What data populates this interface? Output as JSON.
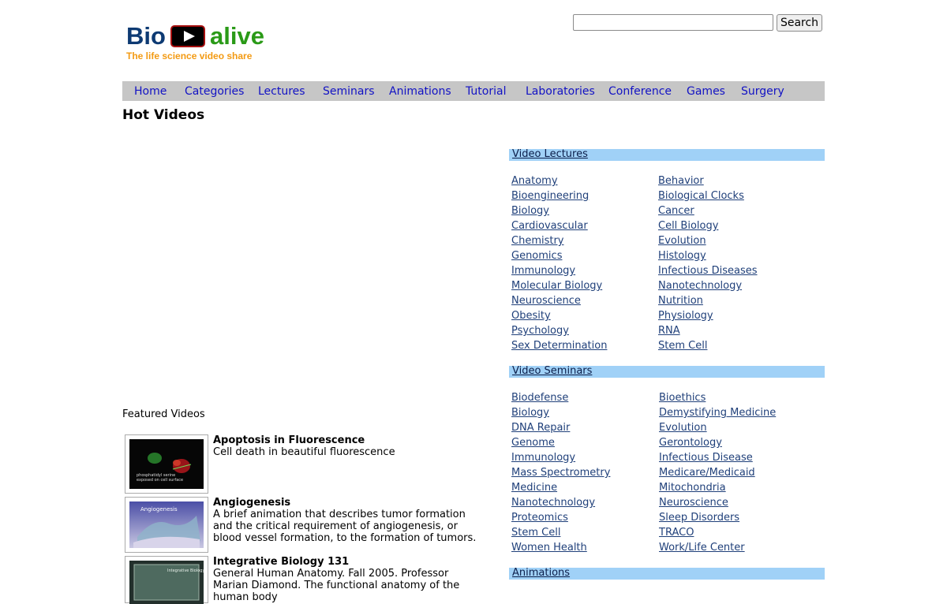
{
  "logo": {
    "bio": "Bio",
    "alive": "alive",
    "tagline": "The life science video share"
  },
  "search": {
    "value": "",
    "placeholder": "",
    "button_label": "Search"
  },
  "nav": [
    "Home",
    "Categories",
    "Lectures",
    "Seminars",
    "Animations",
    "Tutorial",
    "Laboratories",
    "Conference",
    "Games",
    "Surgery"
  ],
  "hot_videos_title": "Hot Videos",
  "featured": {
    "title": "Featured Videos",
    "items": [
      {
        "title": "Apoptosis in Fluorescence",
        "desc": "Cell death in beautiful fluorescence",
        "thumb_caption": "phosphatidyl serine exposed on cell surface"
      },
      {
        "title": "Angiogenesis",
        "desc": "A brief animation that describes tumor formation and the critical requirement of angiogenesis, or blood vessel formation, to the formation of tumors.",
        "thumb_caption": "Angiogenesis"
      },
      {
        "title": "Integrative Biology 131",
        "desc": "General Human Anatomy. Fall 2005. Professor Marian Diamond. The functional anatomy of the human body",
        "thumb_caption": "Integrative Biology"
      }
    ]
  },
  "video_lectures": {
    "heading": "Video Lectures",
    "left": [
      "Anatomy",
      "Bioengineering",
      "Biology",
      "Cardiovascular",
      "Chemistry",
      "Genomics",
      "Immunology",
      "Molecular Biology",
      "Neuroscience",
      "Obesity",
      "Psychology",
      "Sex Determination"
    ],
    "right": [
      "Behavior",
      "Biological Clocks",
      "Cancer",
      "Cell Biology",
      "Evolution",
      "Histology",
      "Infectious Diseases",
      "Nanotechnology",
      "Nutrition",
      "Physiology",
      "RNA",
      "Stem Cell"
    ]
  },
  "video_seminars": {
    "heading": "Video Seminars",
    "left": [
      "Biodefense",
      "Biology",
      "DNA Repair",
      "Genome",
      "Immunology",
      "Mass Spectrometry",
      "Medicine",
      "Nanotechnology",
      "Proteomics",
      "Stem Cell",
      "Women Health"
    ],
    "right": [
      "Bioethics",
      "Demystifying Medicine",
      "Evolution",
      "Gerontology",
      "Infectious Disease",
      "Medicare/Medicaid",
      "Mitochondria",
      "Neuroscience",
      "Sleep Disorders",
      "TRACO",
      "Work/Life Center"
    ]
  },
  "animations_heading": "Animations",
  "colors": {
    "nav_bg": "#c6c6c6",
    "nav_link": "#1212c4",
    "section_head_bg": "#a0d1f7",
    "link": "#20407a",
    "logo_blue": "#0d3a73",
    "logo_green": "#2a9a17",
    "tagline_orange": "#f39a12"
  }
}
